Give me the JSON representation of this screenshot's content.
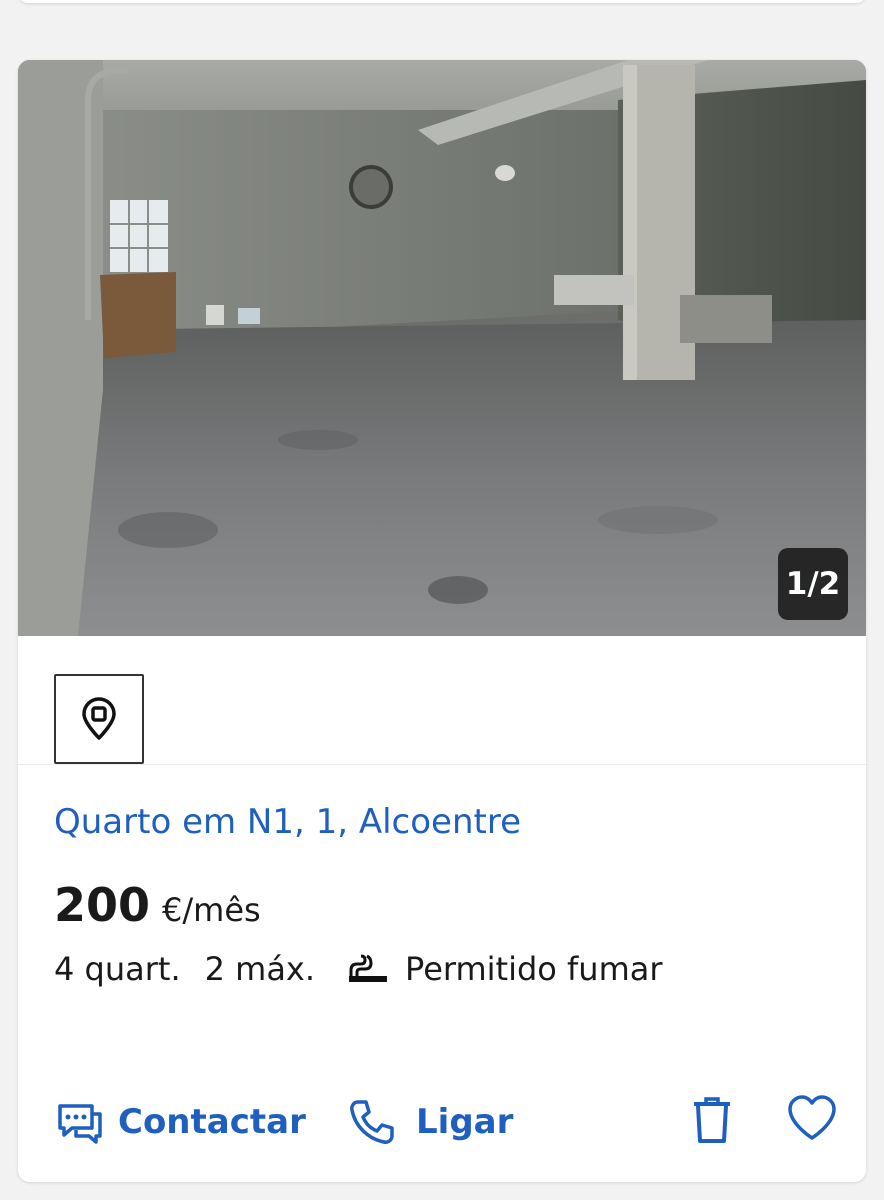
{
  "listing": {
    "photo_counter": "1/2",
    "title": "Quarto em N1, 1, Alcoentre",
    "price": "200",
    "price_unit": "€/mês",
    "rooms": "4 quart.",
    "max_people": "2 máx.",
    "smoking": "Permitido fumar"
  },
  "actions": {
    "contact_label": "Contactar",
    "call_label": "Ligar"
  },
  "colors": {
    "accent": "#1f5fbf",
    "text": "#1a1a1a",
    "background": "#f2f2f2"
  },
  "icons": [
    "map-pin-icon",
    "no-smoking-icon",
    "chat-icon",
    "phone-icon",
    "trash-icon",
    "heart-icon"
  ]
}
